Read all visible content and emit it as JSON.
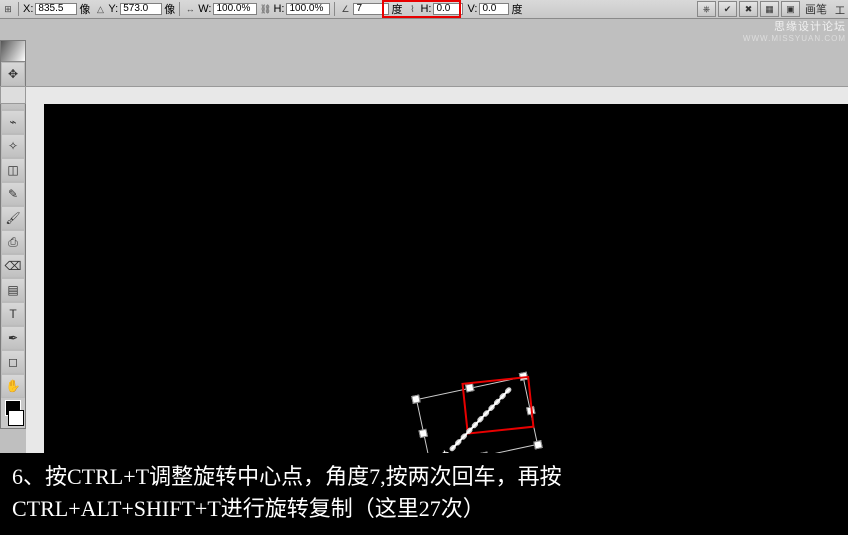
{
  "options_bar": {
    "x_icon": "⊕",
    "x_value": "835.5",
    "x_unit": "像",
    "y_icon": "△",
    "y_value": "573.0",
    "y_unit": "像",
    "w_icon": "↔",
    "w_label": "W:",
    "w_value": "100.0%",
    "link_icon": "⛓",
    "h_label": "H:",
    "h_value": "100.0%",
    "angle_icon": "∠",
    "angle_value": "7",
    "angle_unit": "度",
    "skew_h_icon": "⌇",
    "skew_h_label": "H:",
    "skew_h_value": "0.0",
    "skew_v_label": "V:",
    "skew_v_value": "0.0",
    "skew_v_unit": "度",
    "brush_label": "画笔",
    "btn_icons": [
      "✔",
      "✖",
      "⎈",
      "▦",
      "▣",
      "◧"
    ],
    "menu_label": "工"
  },
  "watermark": {
    "cn": "思缘设计论坛",
    "en": "WWW.MISSYUAN.COM"
  },
  "caption": {
    "line1": "6、按CTRL+T调整旋转中心点，角度7,按两次回车，再按",
    "line2": "CTRL+ALT+SHIFT+T进行旋转复制（这里27次）"
  },
  "tools": [
    {
      "name": "move-tool",
      "glyph": "✥"
    },
    {
      "name": "marquee-tool",
      "glyph": "◌"
    },
    {
      "name": "lasso-tool",
      "glyph": "⌁"
    },
    {
      "name": "wand-tool",
      "glyph": "✧"
    },
    {
      "name": "crop-tool",
      "glyph": "◫"
    },
    {
      "name": "eyedropper-tool",
      "glyph": "✎"
    },
    {
      "name": "brush-tool",
      "glyph": "🖌"
    },
    {
      "name": "stamp-tool",
      "glyph": "⎙"
    },
    {
      "name": "eraser-tool",
      "glyph": "⌫"
    },
    {
      "name": "gradient-tool",
      "glyph": "▤"
    },
    {
      "name": "type-tool",
      "glyph": "T"
    },
    {
      "name": "pen-tool",
      "glyph": "✒"
    },
    {
      "name": "shape-tool",
      "glyph": "◻"
    },
    {
      "name": "hand-tool",
      "glyph": "✋"
    }
  ],
  "colors": {
    "highlight": "#e80000",
    "canvas": "#000000",
    "ui": "#c8c8c8"
  }
}
